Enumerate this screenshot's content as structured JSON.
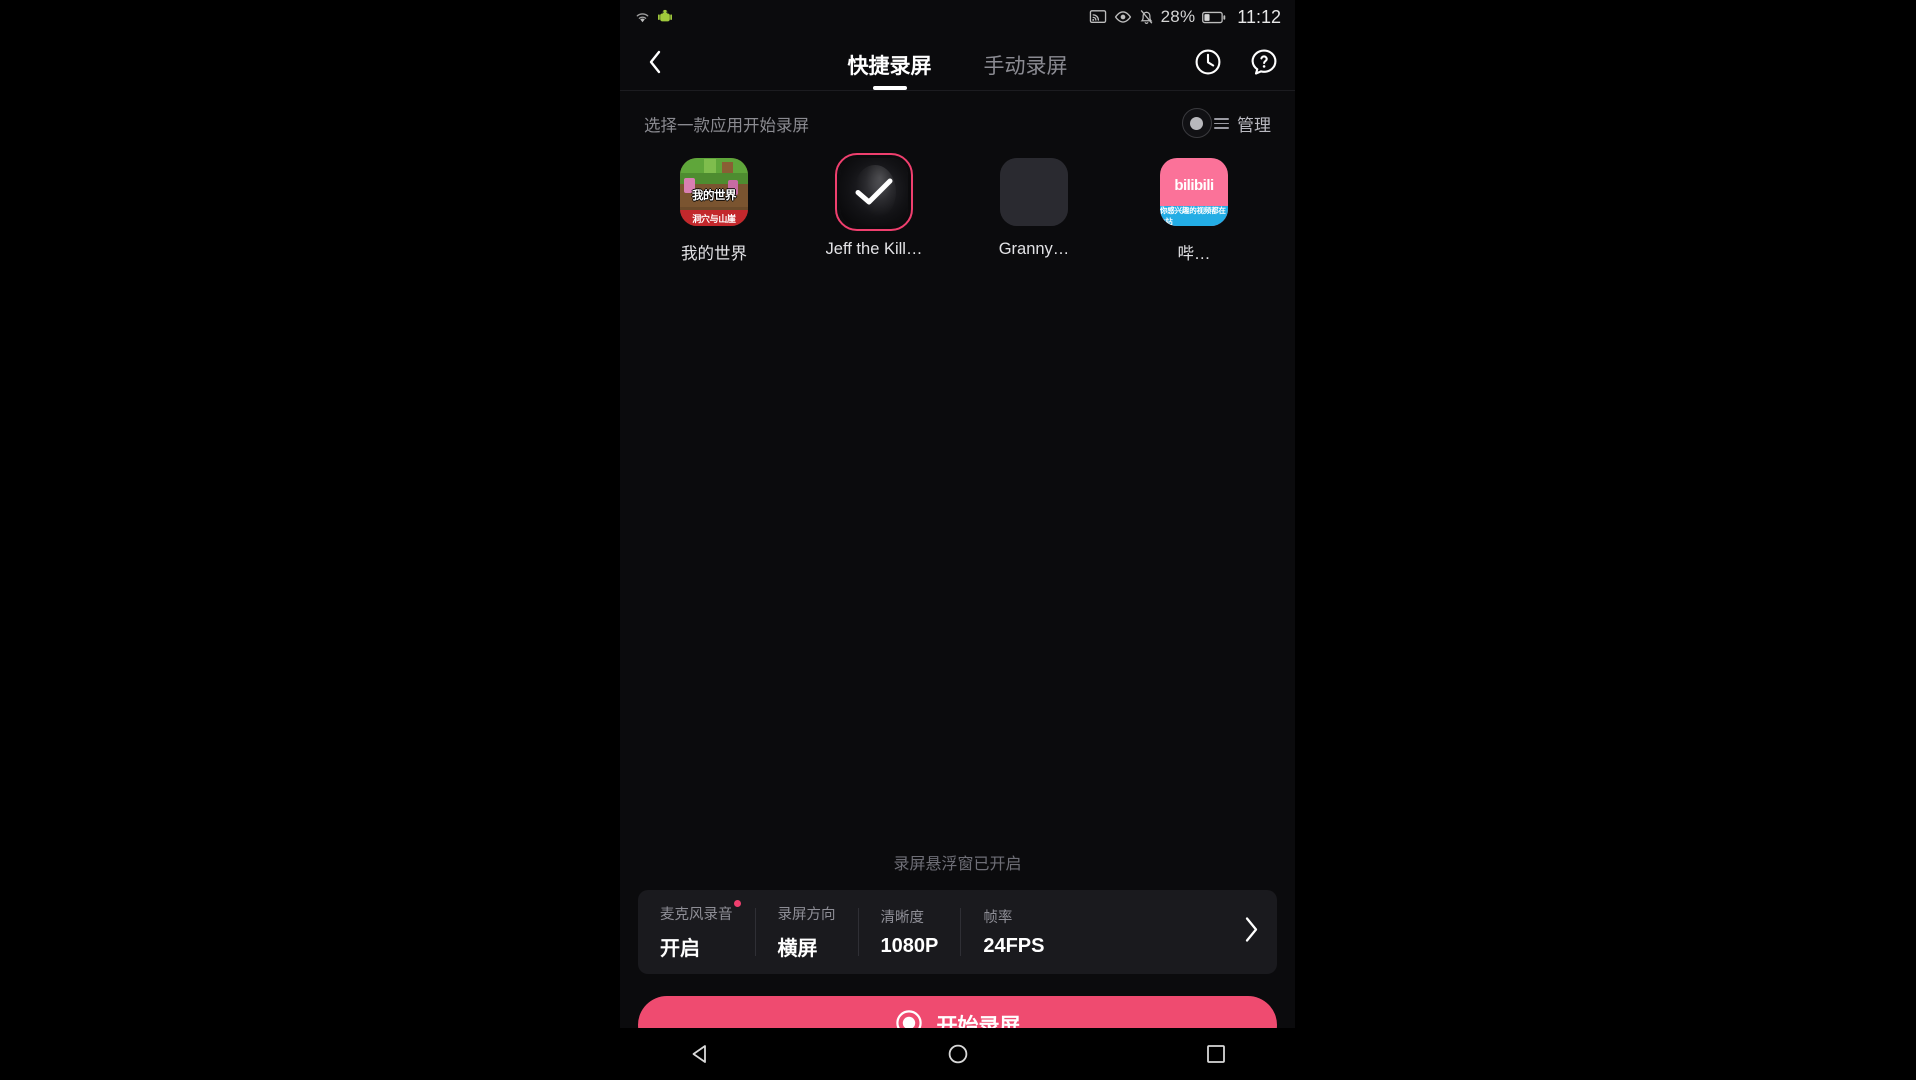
{
  "statusbar": {
    "wifi_icon": "wifi-icon",
    "android_icon": "android-robot-icon",
    "cast_icon": "screen-cast-icon",
    "eye_icon": "eye-care-icon",
    "mute_icon": "notification-muted-icon",
    "battery_percent": "28%",
    "battery_icon": "battery-icon",
    "time": "11:12"
  },
  "header": {
    "back_icon": "back-chevron-icon",
    "tabs": [
      {
        "label": "快捷录屏",
        "active": true
      },
      {
        "label": "手动录屏",
        "active": false
      }
    ],
    "history_icon": "clock-history-icon",
    "help_icon": "question-mark-icon",
    "record_dot_icon": "record-dot-icon"
  },
  "content": {
    "subtitle": "选择一款应用开始录屏",
    "manage_label": "管理",
    "manage_icon": "hamburger-menu-icon",
    "apps": [
      {
        "name": "我的世界",
        "icon": "minecraft-icon",
        "selected": false,
        "art": {
          "title": "我的世界",
          "banner": "洞穴与山崖"
        }
      },
      {
        "name": "Jeff the Kill…",
        "icon": "jeff-the-killer-icon",
        "selected": true,
        "check_icon": "checkmark-icon"
      },
      {
        "name": "Granny…",
        "icon": "granny-icon",
        "selected": false
      },
      {
        "name": "哔…",
        "icon": "bilibili-icon",
        "selected": false,
        "art": {
          "title": "bilibili",
          "banner": "你感兴趣的视频都在B站"
        }
      }
    ]
  },
  "bottom": {
    "float_hint": "录屏悬浮窗已开启",
    "settings": [
      {
        "label": "麦克风录音",
        "value": "开启",
        "badge": true
      },
      {
        "label": "录屏方向",
        "value": "横屏",
        "badge": false
      },
      {
        "label": "清晰度",
        "value": "1080P",
        "badge": false
      },
      {
        "label": "帧率",
        "value": "24FPS",
        "badge": false
      }
    ],
    "settings_chevron_icon": "chevron-right-icon",
    "start_button": {
      "label": "开始录屏",
      "icon": "record-circle-icon",
      "color": "#ef4b70"
    }
  },
  "navbar": {
    "back_icon": "nav-back-triangle-icon",
    "home_icon": "nav-home-circle-icon",
    "recents_icon": "nav-recents-square-icon"
  }
}
